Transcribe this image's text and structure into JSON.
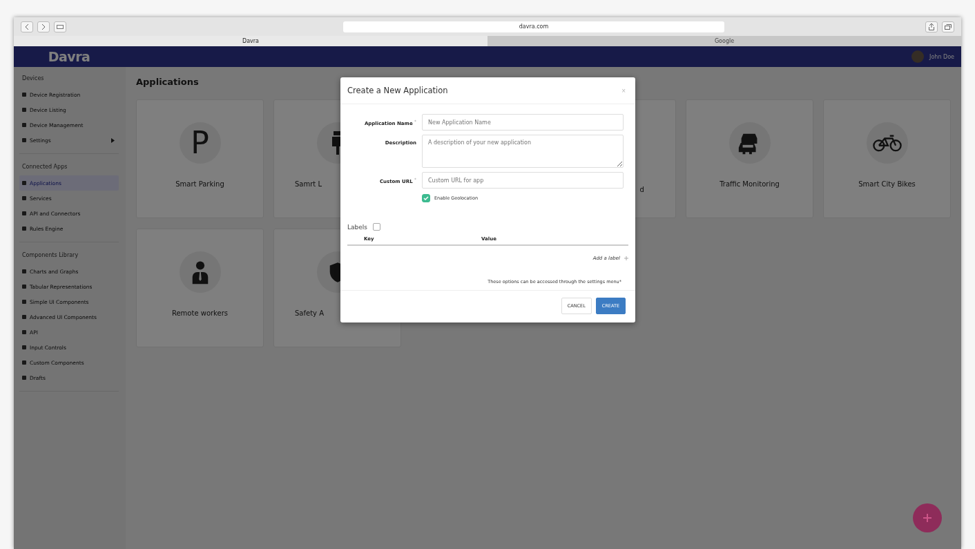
{
  "browser": {
    "url": "davra.com",
    "tabs": [
      {
        "label": "Davra",
        "selected": true
      },
      {
        "label": "Google",
        "selected": false
      }
    ]
  },
  "header": {
    "logo": "Davra",
    "user": "John Doe"
  },
  "sidebar": {
    "groups": [
      {
        "heading": "Devices",
        "items": [
          {
            "label": "Device Registration",
            "selected": false,
            "expandable": false
          },
          {
            "label": "Device Listing",
            "selected": false,
            "expandable": false
          },
          {
            "label": "Device Management",
            "selected": false,
            "expandable": false
          },
          {
            "label": "Settings",
            "selected": false,
            "expandable": true
          }
        ]
      },
      {
        "heading": "Connected Apps",
        "items": [
          {
            "label": "Applications",
            "selected": true,
            "expandable": false
          },
          {
            "label": "Services",
            "selected": false,
            "expandable": false
          },
          {
            "label": "API and Connectors",
            "selected": false,
            "expandable": false
          },
          {
            "label": "Rules Engine",
            "selected": false,
            "expandable": false
          }
        ]
      },
      {
        "heading": "Components Library",
        "items": [
          {
            "label": "Charts and Graphs",
            "selected": false,
            "expandable": false
          },
          {
            "label": "Tabular Representations",
            "selected": false,
            "expandable": false
          },
          {
            "label": "Simple UI Components",
            "selected": false,
            "expandable": false
          },
          {
            "label": "Advanced UI Components",
            "selected": false,
            "expandable": false
          },
          {
            "label": "API",
            "selected": false,
            "expandable": false
          },
          {
            "label": "Input Controls",
            "selected": false,
            "expandable": false
          },
          {
            "label": "Custom Components",
            "selected": false,
            "expandable": false
          },
          {
            "label": "Drafts",
            "selected": false,
            "expandable": false
          }
        ]
      }
    ]
  },
  "main": {
    "title": "Applications",
    "cards": [
      {
        "kind": "parking",
        "label": "Smart Parking",
        "glyph": "P"
      },
      {
        "kind": "lighting",
        "label": "Samrt L"
      },
      {
        "kind": "hidden",
        "label": "d"
      },
      {
        "kind": "traffic",
        "label": "Traffic Monitoring"
      },
      {
        "kind": "bikes",
        "label": "Smart City Bikes"
      },
      {
        "kind": "worker",
        "label": "Remote workers"
      },
      {
        "kind": "safety",
        "label": "Safety A"
      }
    ]
  },
  "dialog": {
    "title": "Create a New Application",
    "close": "×",
    "fields": [
      {
        "kind": "input",
        "label": "Application Name",
        "mark": "*",
        "placeholder": "New Application Name"
      },
      {
        "kind": "textarea",
        "label": "Description",
        "placeholder": "A description of your new application"
      },
      {
        "kind": "input",
        "label": "Custom URL",
        "mark": "*",
        "placeholder": "Custom URL for app"
      }
    ],
    "geolocation": {
      "label": "Enable Geolocation",
      "checked": true
    },
    "labels": {
      "title": "Labels",
      "columns": [
        "Key",
        "Value"
      ],
      "add": "Add a label"
    },
    "note": "These options can be accessed through the settings menu*",
    "buttons": [
      {
        "kind": "secondary",
        "label": "CANCEL"
      },
      {
        "kind": "primary",
        "label": "CREATE"
      }
    ]
  }
}
